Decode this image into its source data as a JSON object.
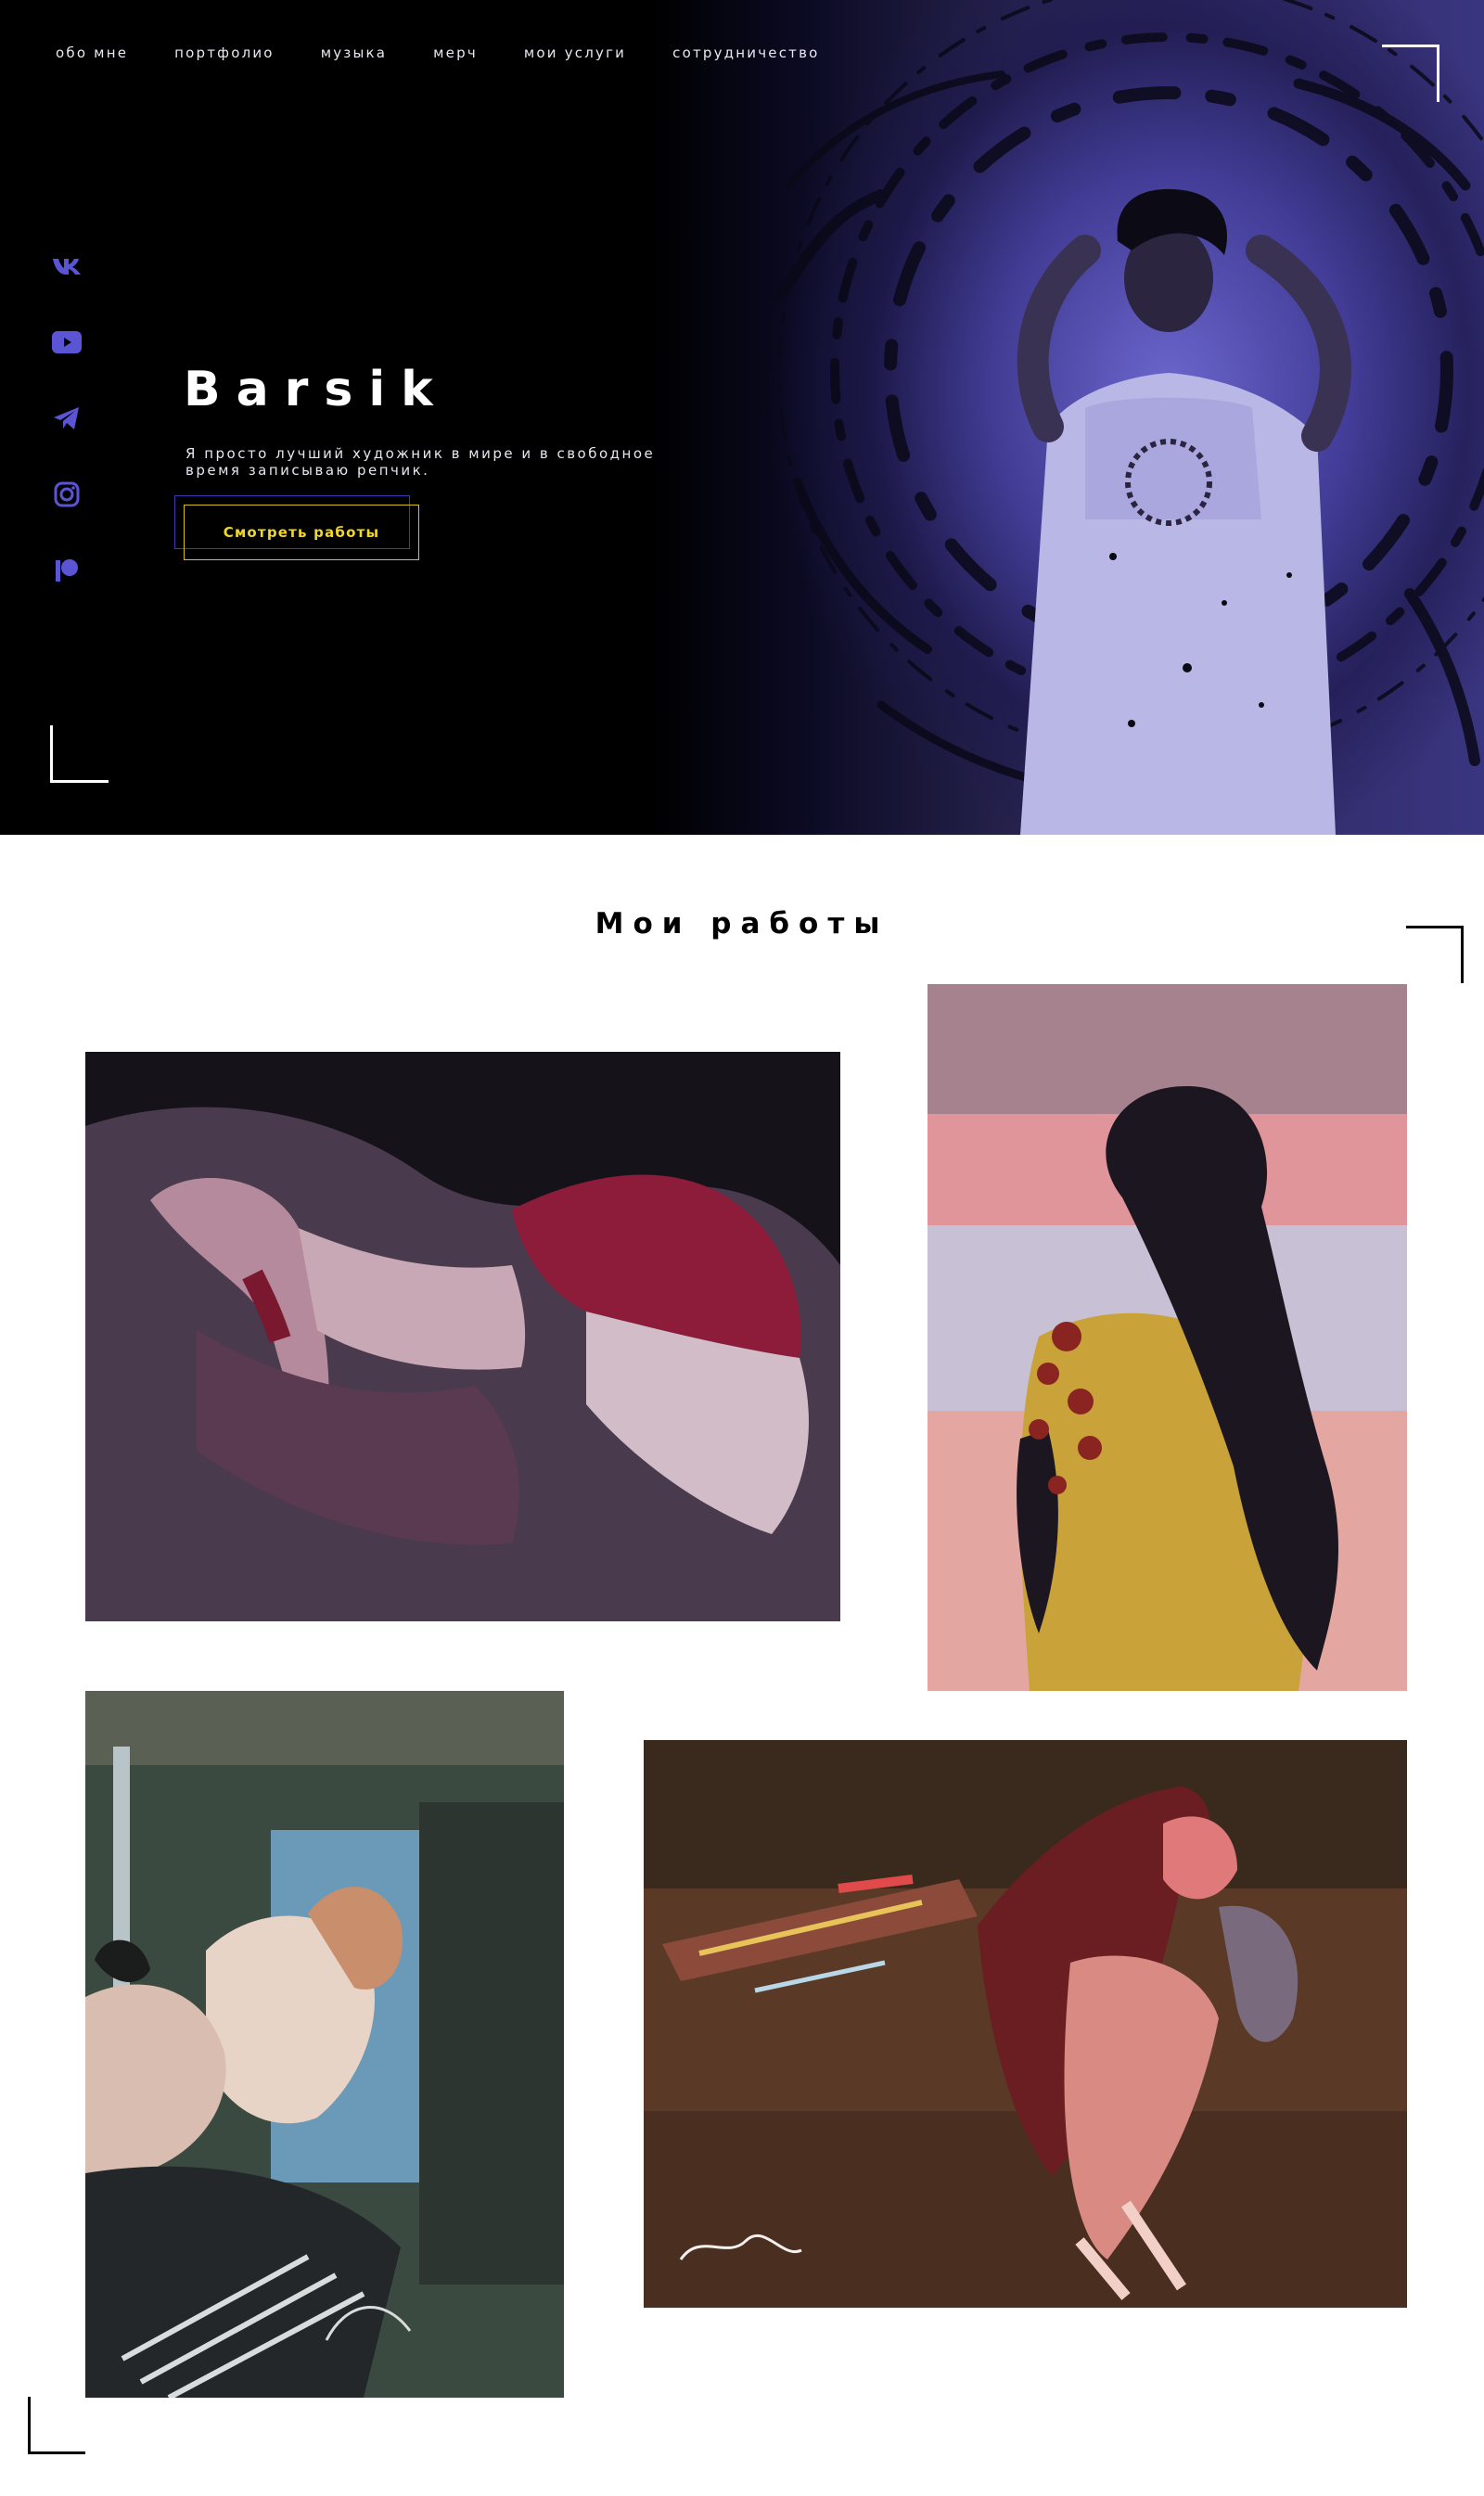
{
  "nav": {
    "items": [
      {
        "label": "обо мне"
      },
      {
        "label": "портфолио"
      },
      {
        "label": "музыка"
      },
      {
        "label": "мерч"
      },
      {
        "label": "мои услуги"
      },
      {
        "label": "сотрудничество"
      }
    ]
  },
  "social": {
    "icons": [
      "vk-icon",
      "youtube-icon",
      "telegram-icon",
      "instagram-icon",
      "patreon-icon"
    ],
    "color": "#5b55d6"
  },
  "hero": {
    "title": "Barsik",
    "description": "Я просто лучший художник в мире и в свободное время записываю репчик.",
    "cta_label": "Смотреть работы",
    "accent_color": "#f0d72a"
  },
  "works": {
    "title": "Мои работы"
  },
  "colors": {
    "hero_background": "#000000",
    "photo_tint": "#5b55d6",
    "page_background": "#ffffff"
  }
}
